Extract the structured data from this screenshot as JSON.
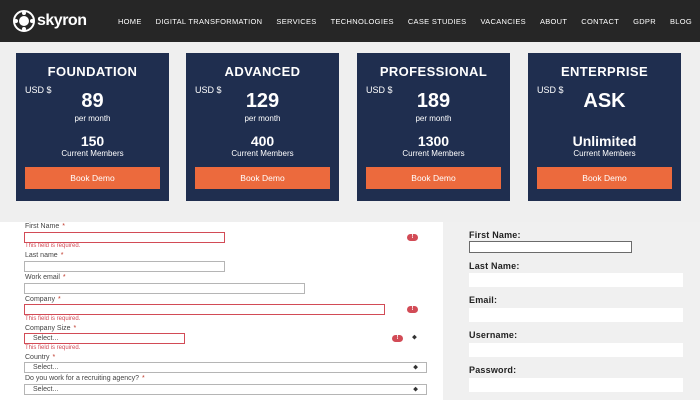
{
  "brand": {
    "logo_text": "skyron"
  },
  "nav": [
    "HOME",
    "DIGITAL TRANSFORMATION",
    "SERVICES",
    "TECHNOLOGIES",
    "CASE STUDIES",
    "VACANCIES",
    "ABOUT",
    "CONTACT",
    "GDPR",
    "BLOG"
  ],
  "plans": [
    {
      "title": "FOUNDATION",
      "currency": "USD $",
      "price": "89",
      "period": "per month",
      "members": "150",
      "members_label": "Current Members",
      "button": "Book Demo"
    },
    {
      "title": "ADVANCED",
      "currency": "USD $",
      "price": "129",
      "period": "per month",
      "members": "400",
      "members_label": "Current Members",
      "button": "Book Demo"
    },
    {
      "title": "PROFESSIONAL",
      "currency": "USD $",
      "price": "189",
      "period": "per month",
      "members": "1300",
      "members_label": "Current Members",
      "button": "Book Demo"
    },
    {
      "title": "ENTERPRISE",
      "currency": "USD $",
      "price": "ASK",
      "period": "",
      "members": "Unlimited",
      "members_label": "Current Members",
      "button": "Book Demo"
    }
  ],
  "form": {
    "first_name": {
      "label": "First Name",
      "required": "*",
      "error": "This field is required.",
      "value": ""
    },
    "last_name": {
      "label": "Last name",
      "required": "*",
      "value": ""
    },
    "work_email": {
      "label": "Work email",
      "required": "*",
      "value": ""
    },
    "company": {
      "label": "Company",
      "required": "*",
      "error": "This field is required.",
      "value": ""
    },
    "company_size": {
      "label": "Company Size",
      "required": "*",
      "selected": "Select...",
      "error": "This field is required."
    },
    "country": {
      "label": "Country",
      "required": "*",
      "selected": "Select..."
    },
    "recruiting": {
      "label": "Do you work for a recruiting agency?",
      "required": "*",
      "selected": "Select..."
    },
    "error_icon": "!",
    "arrow_glyph": "⬥"
  },
  "side_form": {
    "first_name": "First Name:",
    "last_name": "Last Name:",
    "email": "Email:",
    "username": "Username:",
    "password": "Password:"
  },
  "colors": {
    "header_bg": "#262626",
    "card_bg": "#1f2e4f",
    "accent": "#ec6a3d",
    "error": "#d24b56"
  }
}
